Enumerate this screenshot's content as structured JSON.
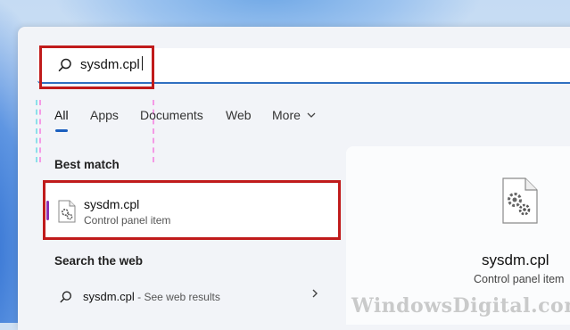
{
  "search": {
    "query": "sysdm.cpl"
  },
  "tabs": [
    {
      "label": "All",
      "active": true
    },
    {
      "label": "Apps"
    },
    {
      "label": "Documents"
    },
    {
      "label": "Web"
    },
    {
      "label": "More"
    }
  ],
  "best_match": {
    "heading": "Best match",
    "title": "sysdm.cpl",
    "subtitle": "Control panel item"
  },
  "search_web": {
    "heading": "Search the web",
    "query": "sysdm.cpl",
    "suffix": " - See web results"
  },
  "preview": {
    "title": "sysdm.cpl",
    "subtitle": "Control panel item"
  },
  "watermark": "WindowsDigital.com",
  "colors": {
    "highlight": "#c01b1b",
    "accent": "#1b5fbf",
    "selection_bar": "#8b2fb4"
  }
}
